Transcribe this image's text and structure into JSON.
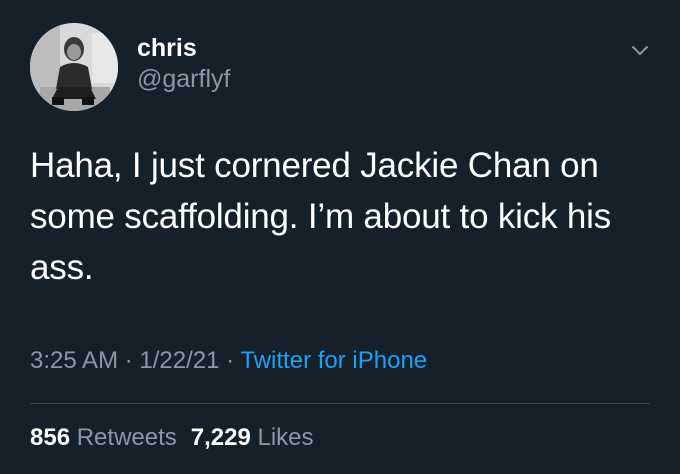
{
  "tweet": {
    "author": {
      "display_name": "chris",
      "handle": "@garflyf",
      "avatar_icon": "profile-photo"
    },
    "menu_icon": "chevron-down-icon",
    "text": "Haha, I just cornered Jackie Chan on some scaffolding. I’m about to kick his ass.",
    "timestamp": {
      "time": "3:25 AM",
      "separator": "·",
      "date": "1/22/21",
      "source": "Twitter for iPhone"
    },
    "stats": {
      "retweets_count": "856",
      "retweets_label": "Retweets",
      "likes_count": "7,229",
      "likes_label": "Likes"
    }
  },
  "colors": {
    "background": "#15202b",
    "text_primary": "#ffffff",
    "text_secondary": "#8899a6",
    "link": "#1da1f2",
    "divider": "#38444d"
  }
}
